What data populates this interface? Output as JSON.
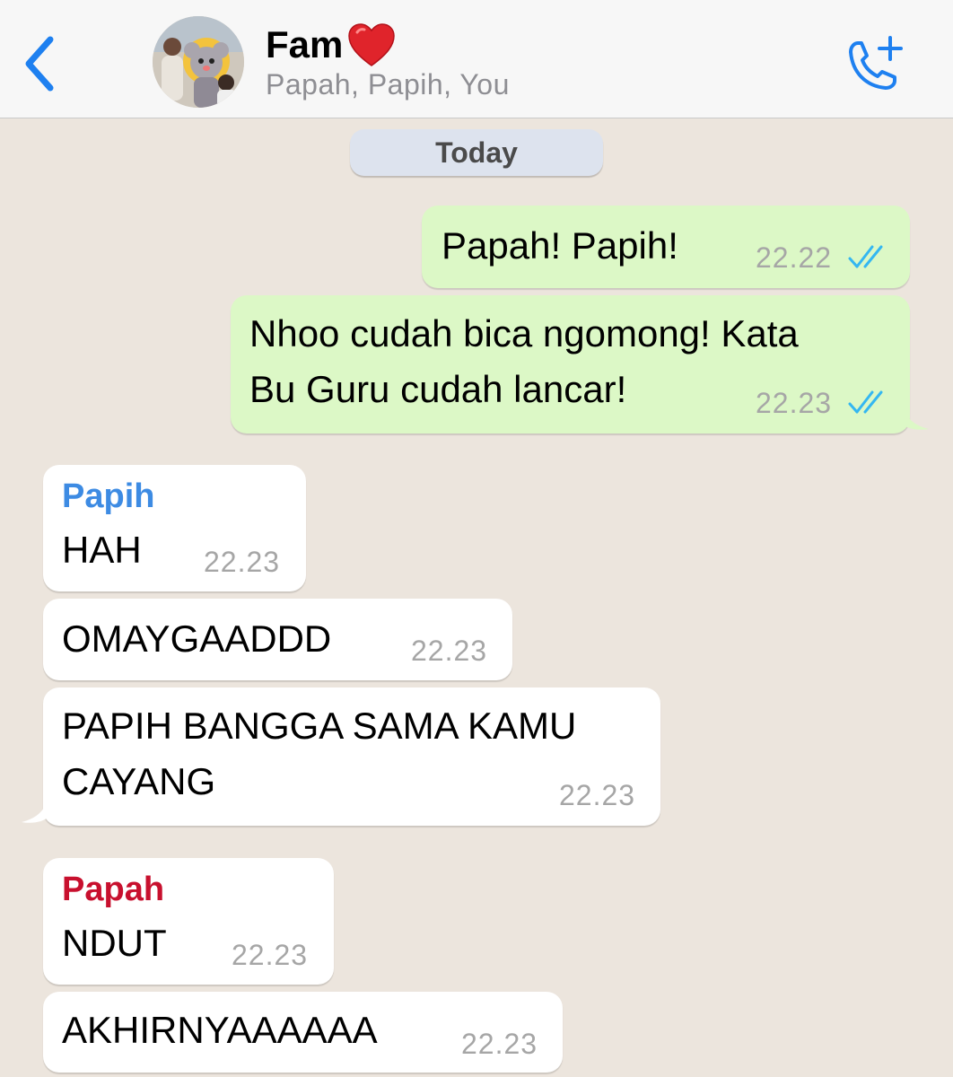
{
  "header": {
    "title": "Fam",
    "subtitle": "Papah, Papih, You",
    "back_icon": "chevron-left-icon",
    "call_icon": "add-call-icon",
    "accent_color": "#1e80f0"
  },
  "date_divider": "Today",
  "messages": {
    "out_1": {
      "text": "Papah! Papih!",
      "time": "22.22",
      "status": "read"
    },
    "out_2": {
      "text_line1": "Nhoo cudah bica ngomong! Kata",
      "text_line2": "Bu Guru cudah lancar!",
      "time": "22.23",
      "status": "read"
    },
    "papih_1": {
      "sender": "Papih",
      "sender_color": "#3d8be3",
      "text": "HAH",
      "time": "22.23"
    },
    "papih_2": {
      "text": "OMAYGAADDD",
      "time": "22.23"
    },
    "papih_3": {
      "text_line1": "PAPIH BANGGA SAMA KAMU",
      "text_line2": "CAYANG",
      "time": "22.23"
    },
    "papah_1": {
      "sender": "Papah",
      "sender_color": "#c8102e",
      "text": "NDUT",
      "time": "22.23"
    },
    "papah_2": {
      "text": "AKHIRNYAAAAAA",
      "time": "22.23"
    }
  },
  "colors": {
    "chat_background": "#ece5dd",
    "outgoing_bubble": "#dcf8c6",
    "incoming_bubble": "#ffffff",
    "read_ticks": "#34b7f1"
  }
}
